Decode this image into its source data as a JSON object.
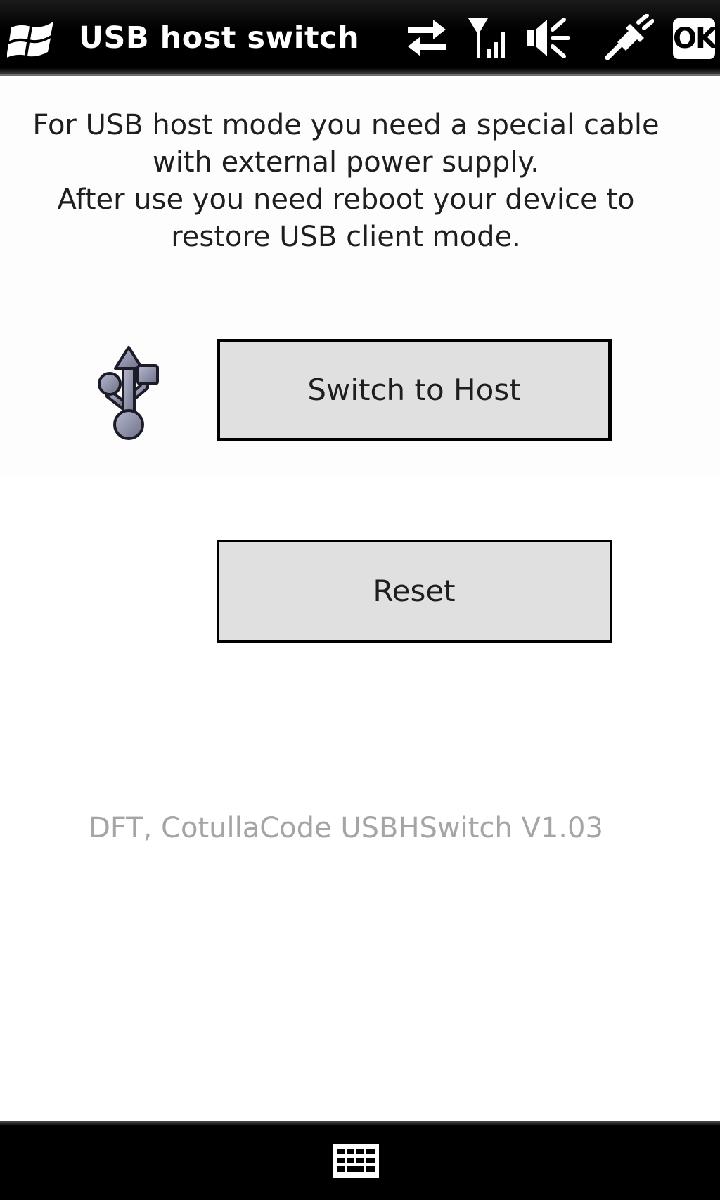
{
  "titlebar": {
    "title": "USB host switch",
    "ok_label": "OK",
    "icons": [
      "windows-start-icon",
      "data-connection-icon",
      "signal-strength-icon",
      "speaker-muted-icon",
      "usb-power-plug-icon"
    ]
  },
  "main": {
    "instructions": [
      "For USB host mode you need a special cable",
      "with external power supply.",
      "After use you need reboot your device to",
      "restore USB client mode."
    ],
    "switch_button_label": "Switch to Host",
    "reset_button_label": "Reset",
    "version_text": "DFT, CotullaCode USBHSwitch V1.03"
  },
  "bottombar": {
    "icon": "keyboard-icon"
  },
  "colors": {
    "titlebar": "#000000",
    "button_face": "#e0e0e0",
    "version_text": "#a5a5a5"
  }
}
